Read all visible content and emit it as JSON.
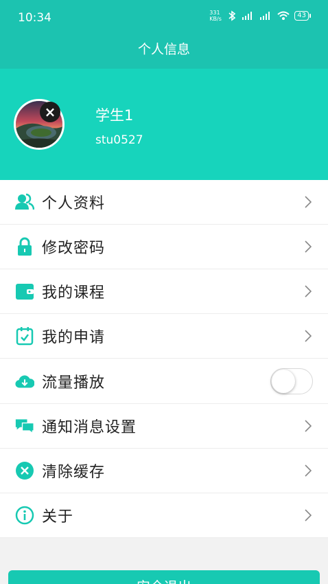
{
  "status_bar": {
    "time": "10:34",
    "net_speed": "331 KB/s",
    "battery": "43"
  },
  "title": "个人信息",
  "profile": {
    "name": "学生1",
    "id": "stu0527"
  },
  "menu": [
    {
      "label": "个人资料",
      "icon": "users-icon"
    },
    {
      "label": "修改密码",
      "icon": "lock-icon"
    },
    {
      "label": "我的课程",
      "icon": "wallet-icon"
    },
    {
      "label": "我的申请",
      "icon": "calendar-check-icon"
    },
    {
      "label": "流量播放",
      "icon": "cloud-download-icon",
      "toggle": false
    },
    {
      "label": "通知消息设置",
      "icon": "chat-bubbles-icon"
    },
    {
      "label": "清除缓存",
      "icon": "clear-circle-icon"
    },
    {
      "label": "关于",
      "icon": "info-icon"
    }
  ],
  "logout_label": "安全退出",
  "colors": {
    "header": "#1cc3b0",
    "profile_bg": "#17d4bc",
    "icon": "#17c9b2"
  }
}
